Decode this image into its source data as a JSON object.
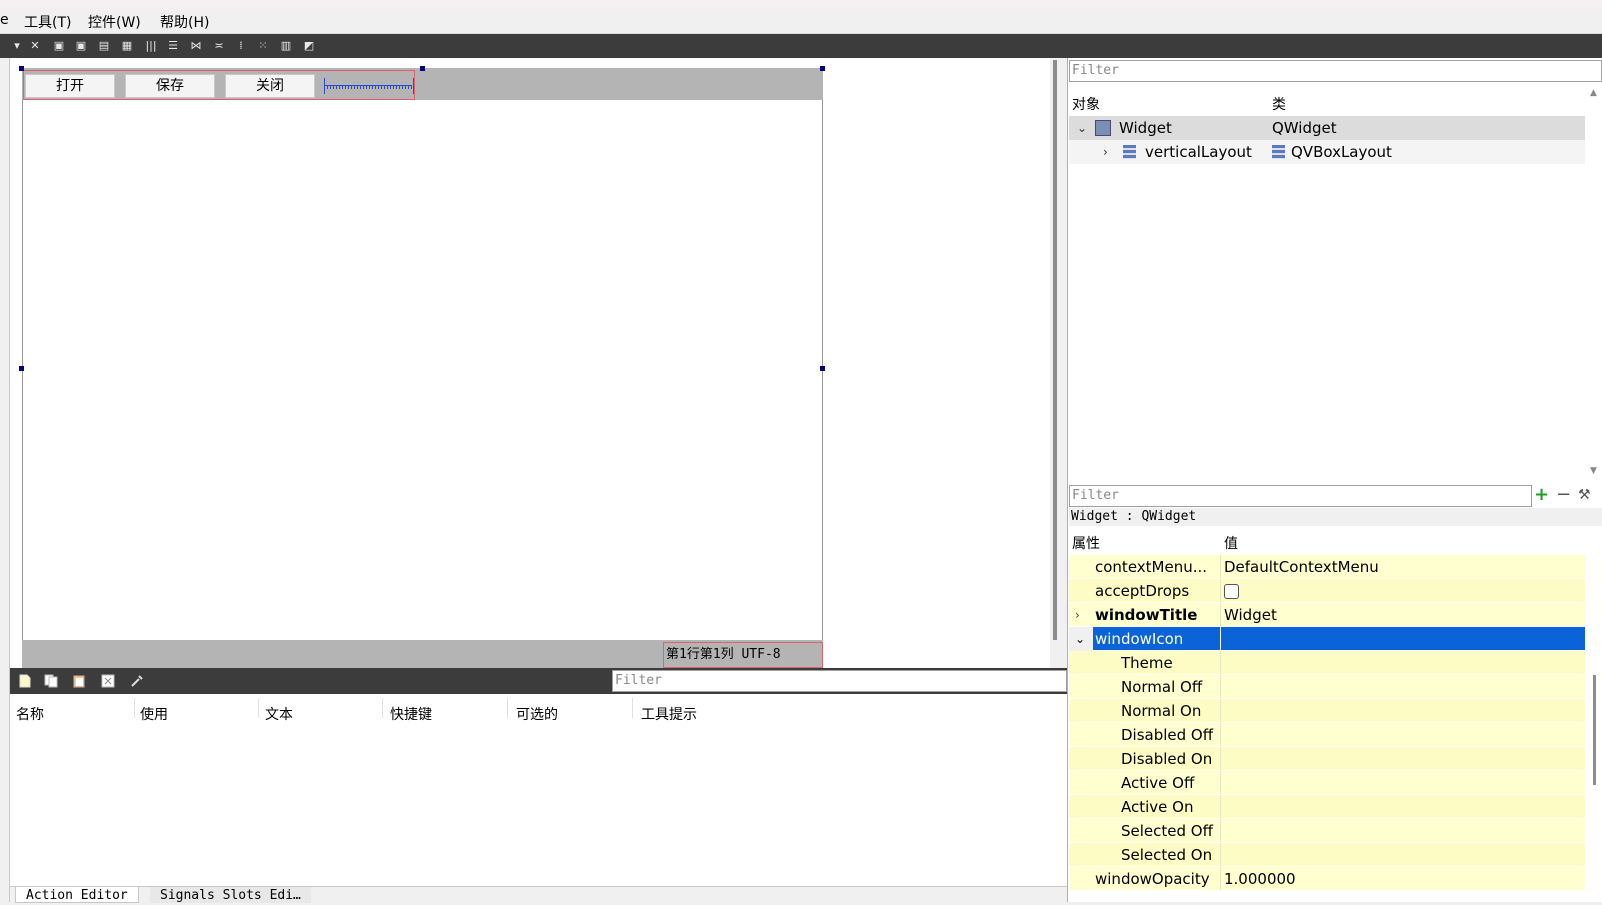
{
  "menubar": {
    "partial_item": "e",
    "items": [
      "工具(T)",
      "控件(W)",
      "帮助(H)"
    ]
  },
  "form": {
    "buttons": [
      "打开",
      "保存",
      "关闭"
    ],
    "status": "第1行第1列  UTF-8"
  },
  "action_editor": {
    "filter_placeholder": "Filter",
    "columns": [
      "名称",
      "使用",
      "文本",
      "快捷键",
      "可选的",
      "工具提示"
    ]
  },
  "bottom_tabs": [
    "Action Editor",
    "Signals  Slots Edi…"
  ],
  "object_inspector": {
    "filter_placeholder": "Filter",
    "columns": [
      "对象",
      "类"
    ],
    "rows": [
      {
        "name": "Widget",
        "class": "QWidget"
      },
      {
        "name": "verticalLayout",
        "class": "QVBoxLayout"
      }
    ]
  },
  "property_editor": {
    "filter_placeholder": "Filter",
    "context": "Widget : QWidget",
    "columns": [
      "属性",
      "值"
    ],
    "rows": [
      {
        "name": "contextMenu...",
        "value": "DefaultContextMenu"
      },
      {
        "name": "acceptDrops",
        "value": ""
      },
      {
        "name": "windowTitle",
        "value": "Widget"
      },
      {
        "name": "windowIcon",
        "value": ""
      },
      {
        "name": "Theme",
        "value": ""
      },
      {
        "name": "Normal Off",
        "value": ""
      },
      {
        "name": "Normal On",
        "value": ""
      },
      {
        "name": "Disabled Off",
        "value": ""
      },
      {
        "name": "Disabled On",
        "value": ""
      },
      {
        "name": "Active Off",
        "value": ""
      },
      {
        "name": "Active On",
        "value": ""
      },
      {
        "name": "Selected Off",
        "value": ""
      },
      {
        "name": "Selected On",
        "value": ""
      },
      {
        "name": "windowOpacity",
        "value": "1.000000"
      }
    ]
  },
  "colors": {
    "toolbar_bg": "#3c3c3c",
    "selection": "#0a64d8",
    "property_bg": "#ffffd0",
    "form_bar": "#b4b4b4"
  }
}
